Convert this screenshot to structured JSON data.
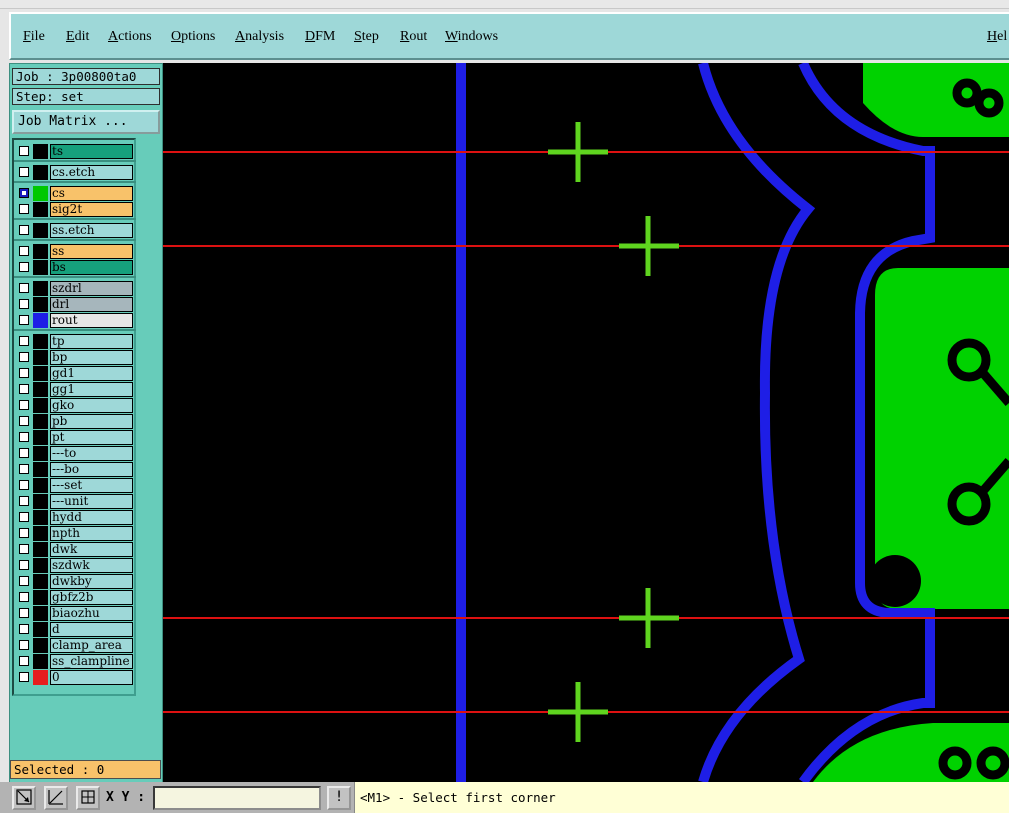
{
  "menubar": {
    "items": [
      {
        "label": "File"
      },
      {
        "label": "Edit"
      },
      {
        "label": "Actions"
      },
      {
        "label": "Options"
      },
      {
        "label": "Analysis"
      },
      {
        "label": "DFM"
      },
      {
        "label": "Step"
      },
      {
        "label": "Rout"
      },
      {
        "label": "Windows"
      },
      {
        "label": "Hel"
      }
    ]
  },
  "job": {
    "job_text": "Job : 3p00800ta0",
    "step_text": "Step: set",
    "matrix_button": "Job Matrix ..."
  },
  "layers": [
    {
      "name": "ts",
      "color": "#16a07c",
      "swatch": "#000000"
    },
    {
      "name": "cs.etch",
      "color": "#9ed8d8",
      "swatch": "#000000"
    },
    {
      "name": "cs",
      "color": "#f8c26a",
      "swatch": "#00c800"
    },
    {
      "name": "sig2t",
      "color": "#f8c26a",
      "swatch": "#000000"
    },
    {
      "name": "ss.etch",
      "color": "#9ed8d8",
      "swatch": "#000000"
    },
    {
      "name": "ss",
      "color": "#f8c26a",
      "swatch": "#000000"
    },
    {
      "name": "bs",
      "color": "#16a07c",
      "swatch": "#000000"
    },
    {
      "name": "szdrl",
      "color": "#a6b6bc",
      "swatch": "#000000"
    },
    {
      "name": "drl",
      "color": "#a6b6bc",
      "swatch": "#000000"
    },
    {
      "name": "rout",
      "color": "#e6e6e6",
      "swatch": "#1e1ee6"
    },
    {
      "name": "tp",
      "color": "#9ed8d8",
      "swatch": "#000000"
    },
    {
      "name": "bp",
      "color": "#9ed8d8",
      "swatch": "#000000"
    },
    {
      "name": "gd1",
      "color": "#9ed8d8",
      "swatch": "#000000"
    },
    {
      "name": "gg1",
      "color": "#9ed8d8",
      "swatch": "#000000"
    },
    {
      "name": "gko",
      "color": "#9ed8d8",
      "swatch": "#000000"
    },
    {
      "name": "pb",
      "color": "#9ed8d8",
      "swatch": "#000000"
    },
    {
      "name": "pt",
      "color": "#9ed8d8",
      "swatch": "#000000"
    },
    {
      "name": "---to",
      "color": "#9ed8d8",
      "swatch": "#000000"
    },
    {
      "name": "---bo",
      "color": "#9ed8d8",
      "swatch": "#000000"
    },
    {
      "name": "---set",
      "color": "#9ed8d8",
      "swatch": "#000000"
    },
    {
      "name": "---unit",
      "color": "#9ed8d8",
      "swatch": "#000000"
    },
    {
      "name": "hydd",
      "color": "#9ed8d8",
      "swatch": "#000000"
    },
    {
      "name": "npth",
      "color": "#9ed8d8",
      "swatch": "#000000"
    },
    {
      "name": "dwk",
      "color": "#9ed8d8",
      "swatch": "#000000"
    },
    {
      "name": "szdwk",
      "color": "#9ed8d8",
      "swatch": "#000000"
    },
    {
      "name": "dwkby",
      "color": "#9ed8d8",
      "swatch": "#000000"
    },
    {
      "name": "gbfz2b",
      "color": "#9ed8d8",
      "swatch": "#000000"
    },
    {
      "name": "biaozhu",
      "color": "#9ed8d8",
      "swatch": "#000000"
    },
    {
      "name": "d",
      "color": "#9ed8d8",
      "swatch": "#000000"
    },
    {
      "name": "clamp_area",
      "color": "#9ed8d8",
      "swatch": "#000000"
    },
    {
      "name": "ss_clampline",
      "color": "#9ed8d8",
      "swatch": "#000000"
    },
    {
      "name": "0",
      "color": "#9ed8d8",
      "swatch": "#e61e1e"
    }
  ],
  "selected_text": "Selected : 0",
  "status": {
    "xy_label": "X Y :",
    "xy_value": "",
    "message": "<M1> - Select first corner",
    "tools": [
      "zoom-box-icon",
      "measure-icon",
      "grid-icon"
    ],
    "alert_icon": "!"
  },
  "colors": {
    "board_green": "#00d200",
    "rout_blue": "#1e1ee6",
    "guide_red": "#dd1111",
    "cross_green": "#5fd41f"
  }
}
